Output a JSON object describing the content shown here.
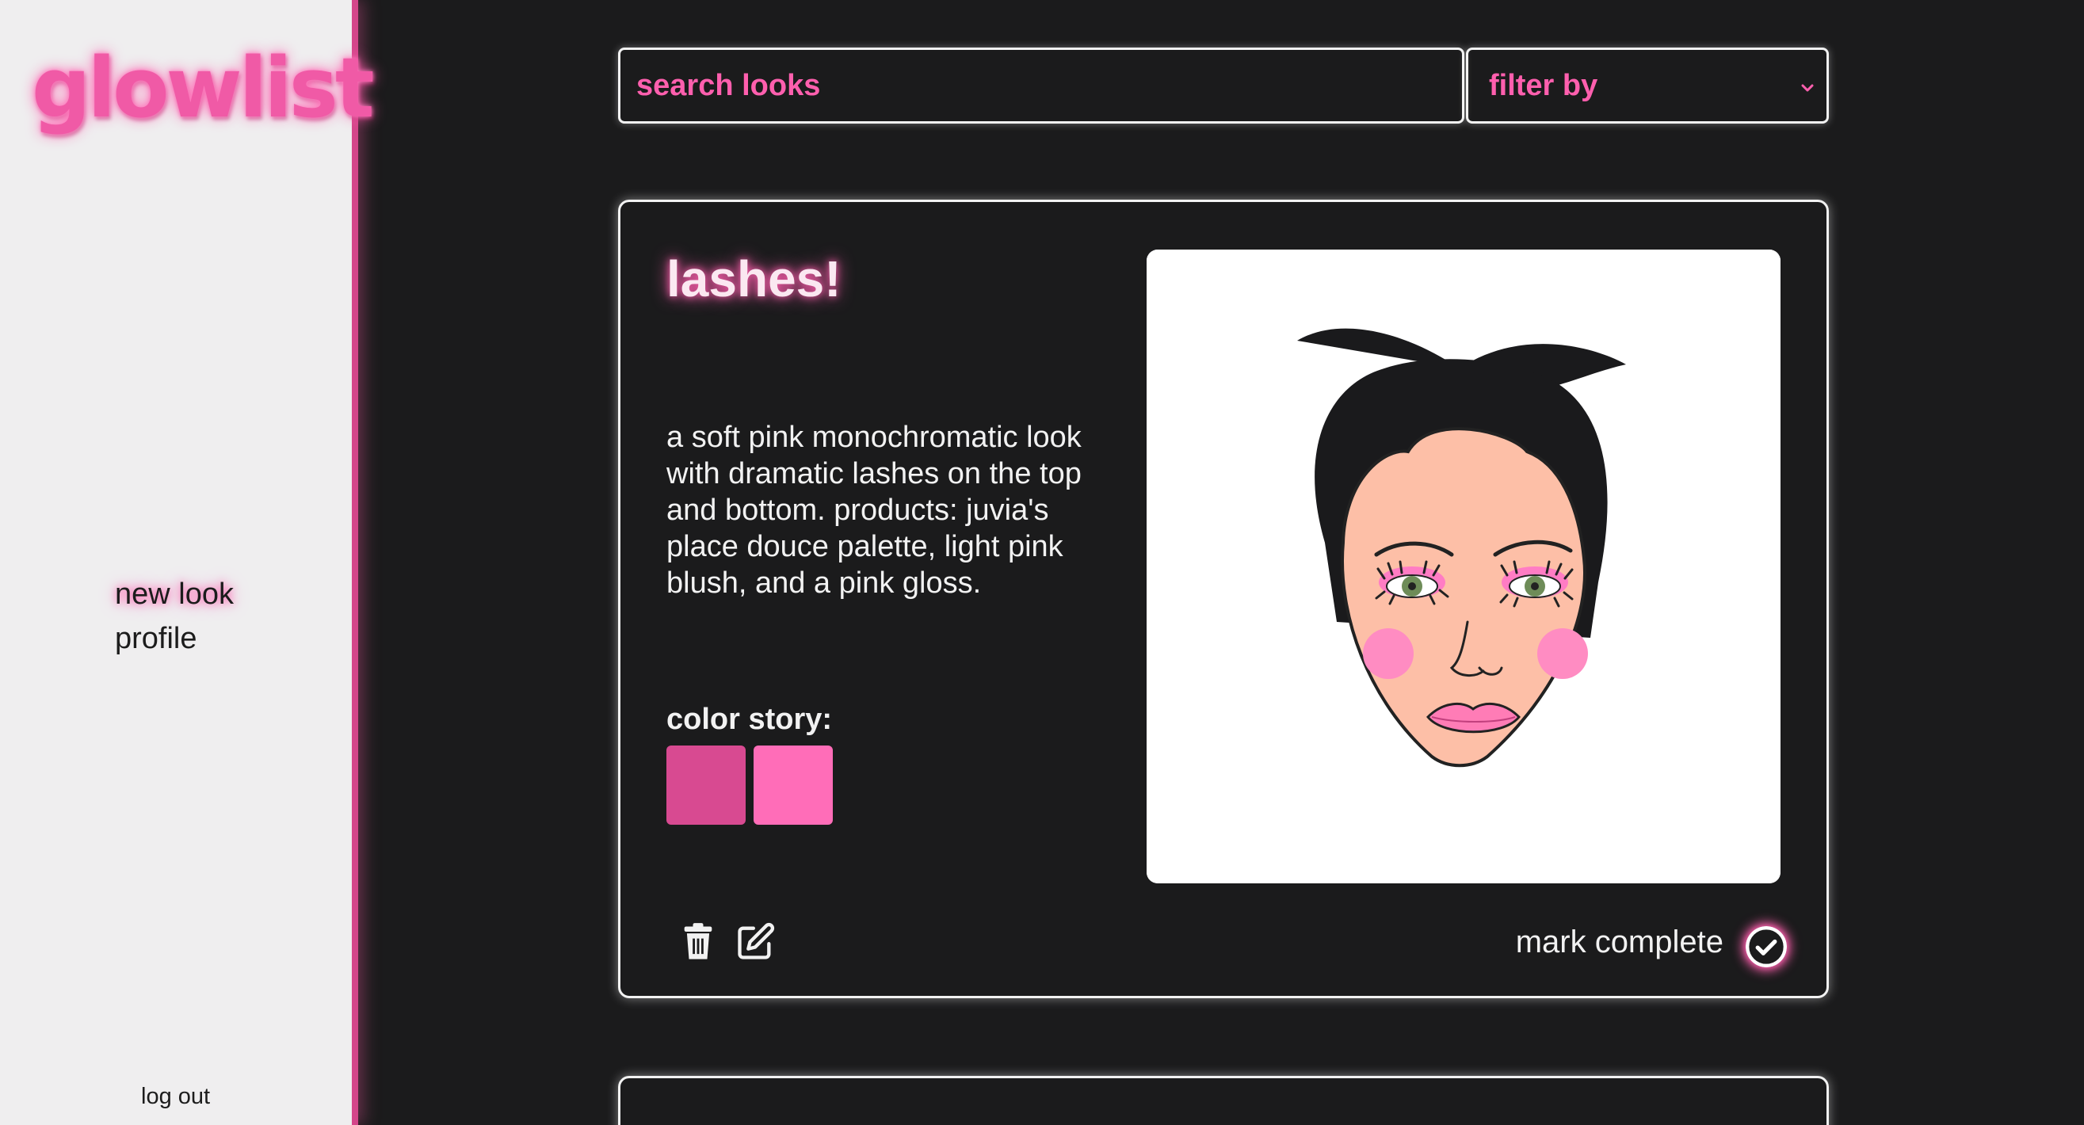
{
  "app": {
    "logo": "glowlist"
  },
  "sidebar": {
    "items": [
      {
        "label": "new look"
      },
      {
        "label": "profile"
      }
    ],
    "logout": "log out"
  },
  "toolbar": {
    "search_placeholder": "search looks",
    "filter_label": "filter by"
  },
  "look": {
    "title": "lashes!",
    "description": "a soft pink monochromatic look with dramatic lashes on the top and bottom. products: juvia's place douce palette, light pink blush, and a pink gloss.",
    "color_story_label": "color story:",
    "swatches": [
      "#d84a91",
      "#ff6db8"
    ],
    "mark_complete": "mark complete"
  },
  "colors": {
    "accent": "#ff5fae",
    "background": "#1b1b1c",
    "sidebar": "#efeeef"
  }
}
